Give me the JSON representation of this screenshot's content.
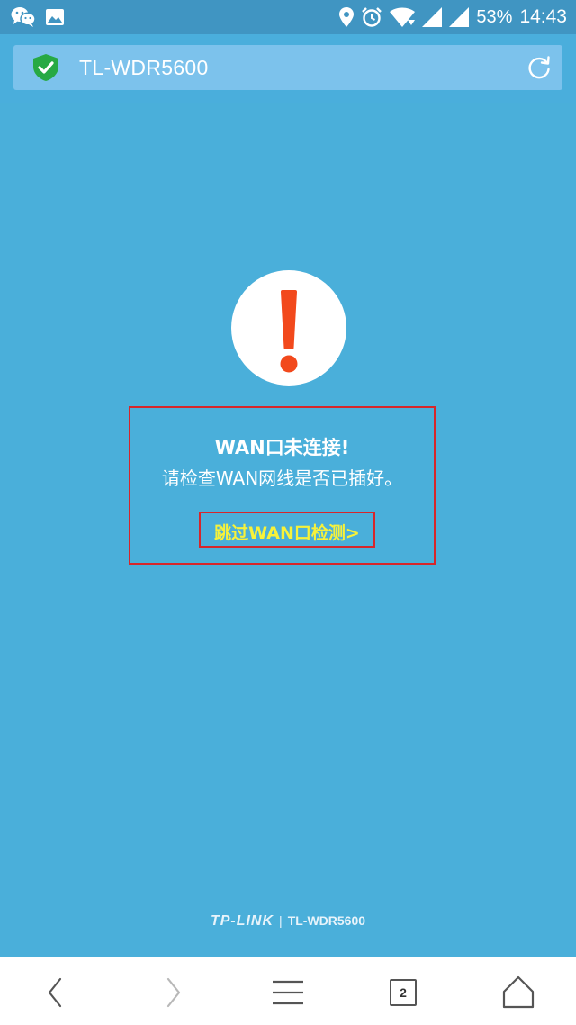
{
  "status_bar": {
    "battery_percent": "53%",
    "time": "14:43",
    "icons": [
      "wechat-icon",
      "image-icon",
      "location-icon",
      "alarm-icon",
      "wifi-icon",
      "signal-icon",
      "signal-icon",
      "battery-icon"
    ]
  },
  "browser": {
    "url_title": "TL-WDR5600",
    "security_icon": "shield-check-icon",
    "reload_icon": "reload-icon"
  },
  "alert": {
    "icon": "exclamation-icon",
    "title": "WAN口未连接!",
    "subtitle": "请检查WAN网线是否已插好。",
    "skip_link": "跳过WAN口检测>"
  },
  "footer": {
    "brand": "TP-LINK",
    "separator": "|",
    "model": "TL-WDR5600"
  },
  "bottom_nav": {
    "tab_count": "2",
    "items": [
      "back-icon",
      "forward-icon",
      "menu-icon",
      "tabs-icon",
      "home-icon"
    ]
  },
  "colors": {
    "background": "#4aafda",
    "status_bar": "#4095c2",
    "address_bar": "#7cc2ec",
    "highlight_border": "#d7262b",
    "link": "#f7f23a",
    "exclamation": "#f2491c"
  }
}
